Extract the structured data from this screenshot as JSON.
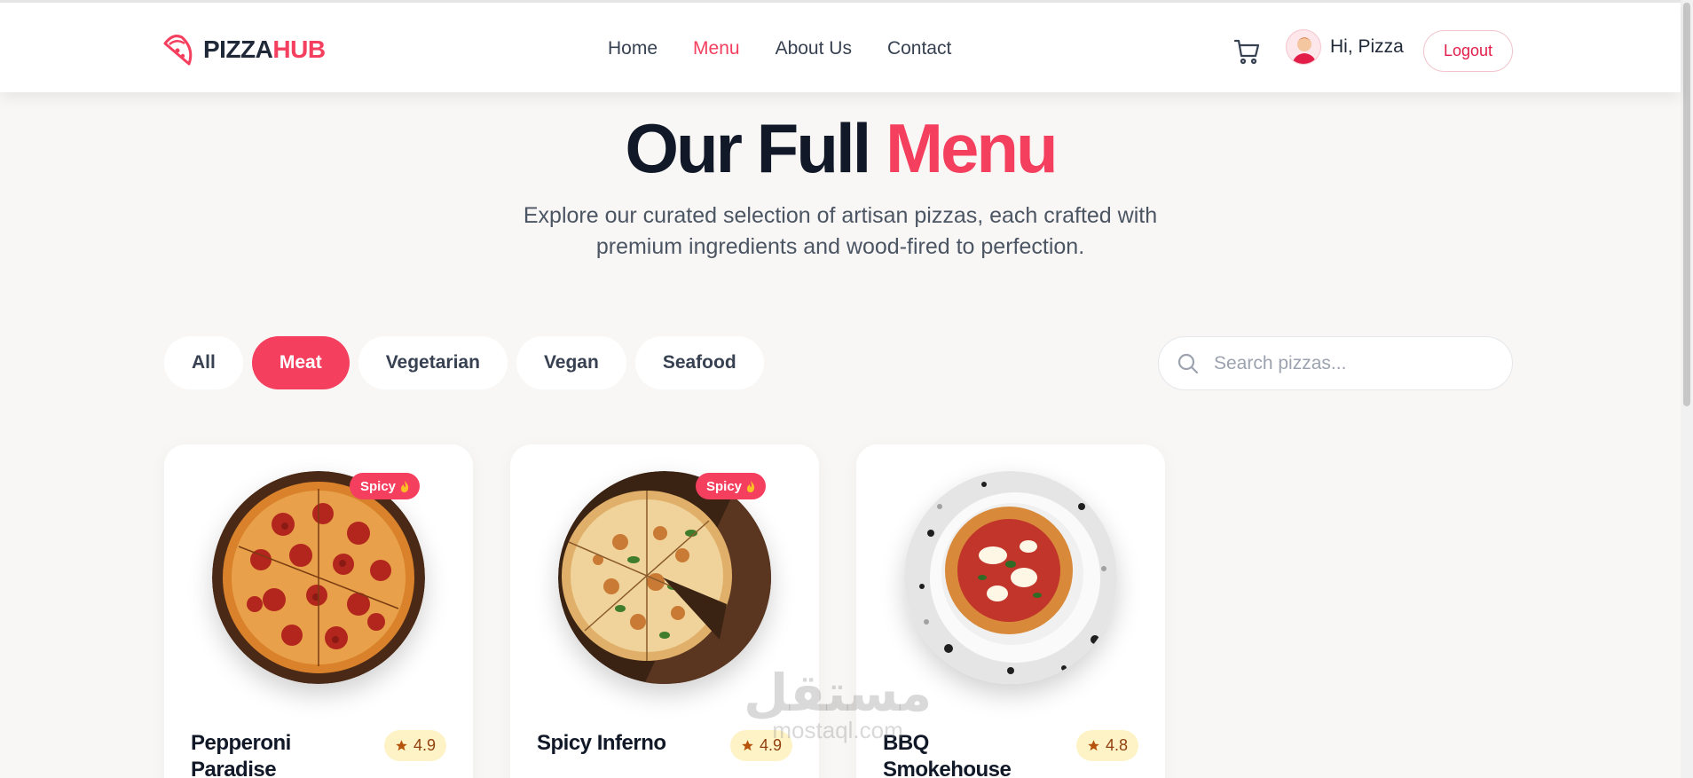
{
  "brand": {
    "name_part1": "PIZZA",
    "name_part2": "HUB",
    "accent": "#f43f5e"
  },
  "nav": {
    "items": [
      {
        "label": "Home",
        "active": false
      },
      {
        "label": "Menu",
        "active": true
      },
      {
        "label": "About Us",
        "active": false
      },
      {
        "label": "Contact",
        "active": false
      }
    ]
  },
  "header": {
    "cart_icon": "shopping-cart-icon",
    "greeting": "Hi, Pizza",
    "logout_label": "Logout"
  },
  "hero": {
    "title_part1": "Our Full",
    "title_part2": "Menu",
    "subtitle": "Explore our curated selection of artisan pizzas, each crafted with premium ingredients and wood-fired to perfection."
  },
  "filters": {
    "items": [
      {
        "label": "All",
        "active": false
      },
      {
        "label": "Meat",
        "active": true
      },
      {
        "label": "Vegetarian",
        "active": false
      },
      {
        "label": "Vegan",
        "active": false
      },
      {
        "label": "Seafood",
        "active": false
      }
    ]
  },
  "search": {
    "placeholder": "Search pizzas...",
    "value": ""
  },
  "products": [
    {
      "name": "Pepperoni Paradise",
      "rating": "4.9",
      "badge": "Spicy",
      "badge_icon": "fire-icon",
      "description": ""
    },
    {
      "name": "Spicy Inferno",
      "rating": "4.9",
      "badge": "Spicy",
      "badge_icon": "fire-icon",
      "description": ""
    },
    {
      "name": "BBQ Smokehouse",
      "rating": "4.8",
      "badge": "",
      "description": ""
    }
  ],
  "watermark": {
    "arabic": "مستقل",
    "latin": "mostaql.com"
  }
}
